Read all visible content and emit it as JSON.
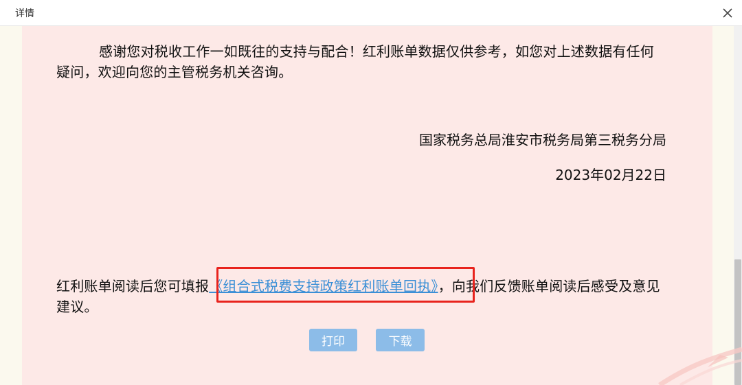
{
  "window": {
    "title": "详情",
    "close_icon": "close-icon"
  },
  "letter": {
    "paragraph": "感谢您对税收工作一如既往的支持与配合！红利账单数据仅供参考，如您对上述数据有任何疑问，欢迎向您的主管税务机关咨询。",
    "organization": "国家税务总局淮安市税务局第三税务分局",
    "date": "2023年02月22日",
    "receipt_prefix": "红利账单阅读后您可填报",
    "receipt_link": "《组合式税费支持政策红利账单回执》",
    "receipt_suffix": "，向我们反馈账单阅读后感受及意见建议。"
  },
  "buttons": {
    "print_label": "打印",
    "download_label": "下载"
  },
  "colors": {
    "content_background": "#fde9e7",
    "link": "#3b8fd6",
    "button": "#8cbce8",
    "highlight": "#e8231d"
  }
}
